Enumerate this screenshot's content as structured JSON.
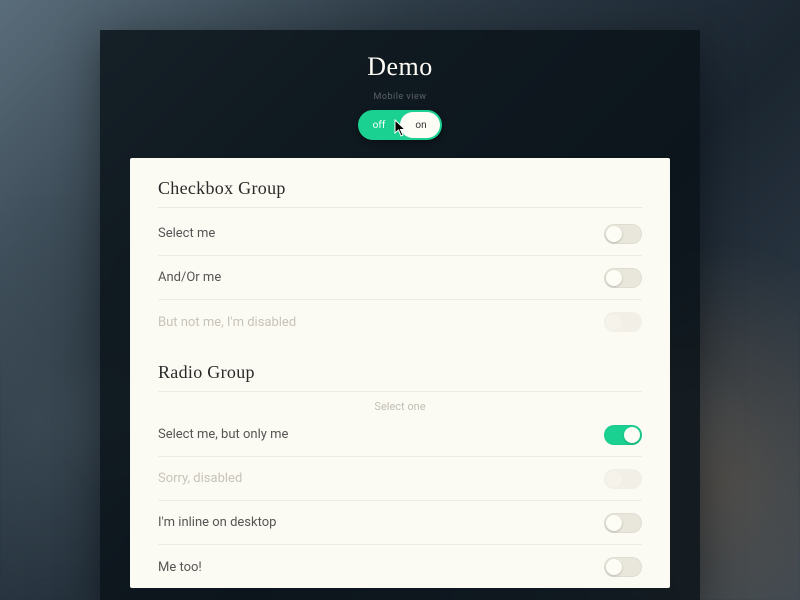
{
  "header": {
    "title": "Demo",
    "toggleCaption": "Mobile view",
    "toggle": {
      "left": "off",
      "right": "on",
      "active": "on"
    }
  },
  "sections": {
    "checkbox": {
      "title": "Checkbox Group",
      "items": [
        {
          "label": "Select me",
          "state": "off",
          "disabled": false
        },
        {
          "label": "And/Or me",
          "state": "off",
          "disabled": false
        },
        {
          "label": "But not me, I'm disabled",
          "state": "off",
          "disabled": true
        }
      ]
    },
    "radio": {
      "title": "Radio Group",
      "caption": "Select one",
      "items": [
        {
          "label": "Select me, but only me",
          "state": "on",
          "disabled": false
        },
        {
          "label": "Sorry, disabled",
          "state": "off",
          "disabled": true
        },
        {
          "label": "I'm inline on desktop",
          "state": "off",
          "disabled": false
        },
        {
          "label": "Me too!",
          "state": "off",
          "disabled": false
        }
      ]
    }
  },
  "colors": {
    "accent": "#1bd192",
    "card": "#fcfbf3",
    "panel": "rgba(10,18,25,0.82)"
  }
}
